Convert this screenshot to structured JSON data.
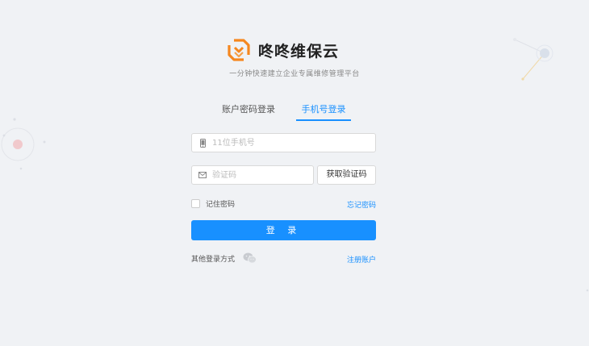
{
  "brand": {
    "name": "咚咚维保云",
    "subtitle": "一分钟快速建立企业专属维修管理平台",
    "accent": "#f5871f"
  },
  "tabs": [
    {
      "label": "账户密码登录",
      "active": false
    },
    {
      "label": "手机号登录",
      "active": true
    }
  ],
  "form": {
    "phone_placeholder": "11位手机号",
    "phone_icon": "mobile-phone-icon",
    "code_placeholder": "验证码",
    "code_icon": "mail-icon",
    "get_code_label": "获取验证码",
    "remember_label": "记住密码",
    "remember_checked": false,
    "forgot_label": "忘记密码",
    "login_label": "登 录"
  },
  "footer": {
    "other_login_label": "其他登录方式",
    "other_login_icon": "wechat-icon",
    "register_label": "注册账户"
  },
  "colors": {
    "primary": "#1890ff",
    "background": "#f0f2f5"
  }
}
